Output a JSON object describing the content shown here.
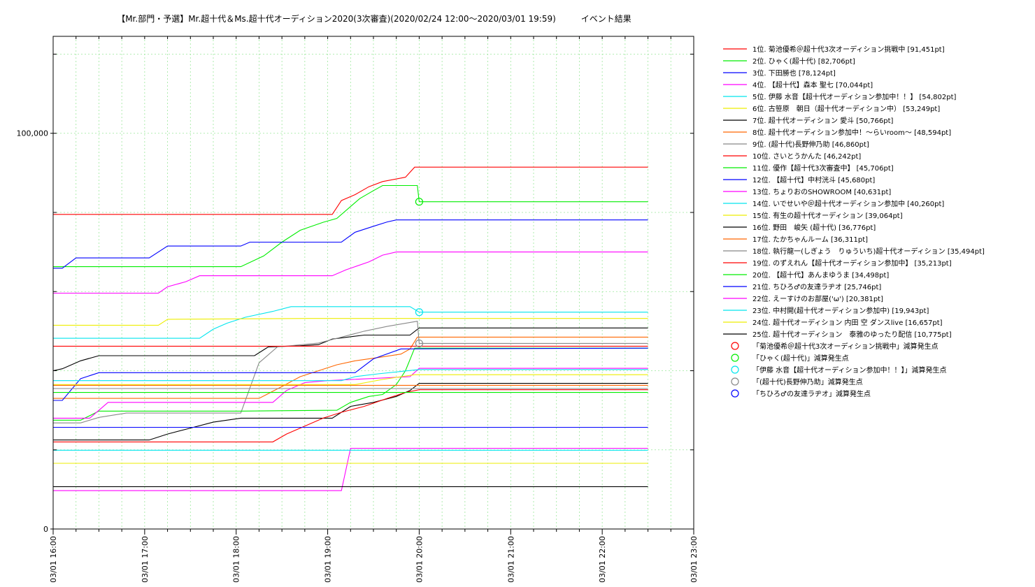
{
  "chart_data": {
    "type": "line",
    "title": "【Mr.部門・予選】Mr.超十代＆Ms.超十代オーディション2020(3次審査)(2020/02/24 12:00～2020/03/01 19:59)　　　イベント結果",
    "xlabel": "",
    "ylabel": "",
    "xlim": [
      0,
      7
    ],
    "ylim": [
      0,
      100000
    ],
    "yticks": [
      {
        "value": 0,
        "label": "0"
      },
      {
        "value": 100000,
        "label": "100,000"
      }
    ],
    "x_tick_labels": [
      "03/01 16:00",
      "03/01 17:00",
      "03/01 18:00",
      "03/01 19:00",
      "03/01 20:00",
      "03/01 21:00",
      "03/01 22:00",
      "03/01 23:00"
    ],
    "grid": true,
    "legend_position": "right",
    "series": [
      {
        "name": "1位. 菊池優希＠超十代3次オーディション挑戦中 [91,451pt]",
        "color": "#ff0000",
        "points": [
          [
            0,
            79500
          ],
          [
            3.05,
            79500
          ],
          [
            3.15,
            83000
          ],
          [
            3.3,
            84500
          ],
          [
            3.45,
            86500
          ],
          [
            3.6,
            87800
          ],
          [
            3.85,
            88900
          ],
          [
            3.95,
            91450
          ],
          [
            6.5,
            91450
          ]
        ]
      },
      {
        "name": "2位. ひゃく(超十代) [82,706pt]",
        "color": "#00ee00",
        "points": [
          [
            0,
            66300
          ],
          [
            2.05,
            66300
          ],
          [
            2.3,
            69000
          ],
          [
            2.5,
            72500
          ],
          [
            2.7,
            75500
          ],
          [
            2.95,
            77500
          ],
          [
            3.1,
            78500
          ],
          [
            3.35,
            83500
          ],
          [
            3.5,
            85500
          ],
          [
            3.6,
            86800
          ],
          [
            3.75,
            86800
          ],
          [
            3.98,
            86800
          ],
          [
            4.0,
            82700
          ],
          [
            6.5,
            82700
          ]
        ]
      },
      {
        "name": "3位. 下田勝也 [78,124pt]",
        "color": "#0000ff",
        "points": [
          [
            0,
            65900
          ],
          [
            0.1,
            65900
          ],
          [
            0.25,
            68500
          ],
          [
            1.05,
            68500
          ],
          [
            1.25,
            71500
          ],
          [
            2.05,
            71500
          ],
          [
            2.15,
            72500
          ],
          [
            3.15,
            72500
          ],
          [
            3.3,
            75000
          ],
          [
            3.5,
            76500
          ],
          [
            3.65,
            77600
          ],
          [
            3.75,
            78100
          ],
          [
            6.5,
            78100
          ]
        ]
      },
      {
        "name": "4位. 【超十代】森本 聖七 [70,044pt]",
        "color": "#ff00ff",
        "points": [
          [
            0,
            59600
          ],
          [
            1.15,
            59600
          ],
          [
            1.25,
            61200
          ],
          [
            1.45,
            62500
          ],
          [
            1.6,
            64000
          ],
          [
            3.05,
            64000
          ],
          [
            3.2,
            65500
          ],
          [
            3.45,
            67500
          ],
          [
            3.6,
            69200
          ],
          [
            3.75,
            70000
          ],
          [
            6.5,
            70000
          ]
        ]
      },
      {
        "name": "5位. 伊藤 水音【超十代オーディション参加中！！】 [54,802pt]",
        "color": "#00e5ee",
        "points": [
          [
            0,
            48200
          ],
          [
            1.6,
            48200
          ],
          [
            1.75,
            50500
          ],
          [
            1.9,
            52000
          ],
          [
            2.1,
            53500
          ],
          [
            2.4,
            55000
          ],
          [
            2.6,
            56200
          ],
          [
            3.9,
            56200
          ],
          [
            4.0,
            54800
          ],
          [
            6.5,
            54800
          ]
        ]
      },
      {
        "name": "6位. 古笹原　朝日（超十代オーディション中） [53,249pt]",
        "color": "#eeee00",
        "points": [
          [
            0,
            51500
          ],
          [
            1.15,
            51500
          ],
          [
            1.25,
            53000
          ],
          [
            2.8,
            53200
          ],
          [
            6.5,
            53200
          ]
        ]
      },
      {
        "name": "7位. 超十代オーディション 愛斗 [50,766pt]",
        "color": "#000000",
        "points": [
          [
            0,
            40000
          ],
          [
            0.1,
            40500
          ],
          [
            0.3,
            42500
          ],
          [
            0.5,
            43800
          ],
          [
            2.2,
            43800
          ],
          [
            2.35,
            46000
          ],
          [
            2.7,
            46300
          ],
          [
            2.9,
            46600
          ],
          [
            3.05,
            48000
          ],
          [
            3.4,
            49000
          ],
          [
            3.9,
            49000
          ],
          [
            4.0,
            50800
          ],
          [
            6.5,
            50800
          ]
        ]
      },
      {
        "name": "8位. 超十代オーディション参加中！～らいroom～ [48,594pt]",
        "color": "#ff6600",
        "points": [
          [
            0,
            33000
          ],
          [
            2.25,
            33000
          ],
          [
            2.5,
            36000
          ],
          [
            2.7,
            38500
          ],
          [
            2.9,
            40000
          ],
          [
            3.1,
            41500
          ],
          [
            3.3,
            42500
          ],
          [
            3.6,
            43500
          ],
          [
            3.8,
            44200
          ],
          [
            3.9,
            45500
          ],
          [
            3.98,
            48500
          ],
          [
            6.5,
            48500
          ]
        ]
      },
      {
        "name": "9位. (超十代)長野伸乃助 [46,860pt]",
        "color": "#888888",
        "points": [
          [
            0,
            26800
          ],
          [
            0.3,
            26800
          ],
          [
            0.5,
            28200
          ],
          [
            0.8,
            29300
          ],
          [
            2.05,
            29300
          ],
          [
            2.25,
            42000
          ],
          [
            2.45,
            46000
          ],
          [
            2.9,
            47000
          ],
          [
            3.1,
            48200
          ],
          [
            3.4,
            50000
          ],
          [
            3.65,
            51200
          ],
          [
            3.8,
            51800
          ],
          [
            3.98,
            52500
          ],
          [
            4.0,
            46900
          ],
          [
            6.5,
            46900
          ]
        ]
      },
      {
        "name": "10位. さいとうかんた [46,242pt]",
        "color": "#ff0000",
        "points": [
          [
            0,
            46200
          ],
          [
            6.5,
            46200
          ]
        ]
      },
      {
        "name": "11位. 優作【超十代3次審査中】 [45,706pt]",
        "color": "#00ee00",
        "points": [
          [
            0,
            27500
          ],
          [
            0.3,
            27500
          ],
          [
            0.5,
            29800
          ],
          [
            2.05,
            29800
          ],
          [
            3.1,
            30000
          ],
          [
            3.25,
            32000
          ],
          [
            3.45,
            33500
          ],
          [
            3.6,
            34000
          ],
          [
            3.75,
            36500
          ],
          [
            3.85,
            40000
          ],
          [
            3.95,
            45700
          ],
          [
            6.5,
            45700
          ]
        ]
      },
      {
        "name": "12位. 【超十代】中村洸斗 [45,680pt]",
        "color": "#0000ff",
        "points": [
          [
            0,
            32500
          ],
          [
            0.1,
            32500
          ],
          [
            0.3,
            38000
          ],
          [
            0.5,
            39500
          ],
          [
            2.05,
            39500
          ],
          [
            3.3,
            39500
          ],
          [
            3.5,
            43000
          ],
          [
            3.8,
            45500
          ],
          [
            6.5,
            45700
          ]
        ]
      },
      {
        "name": "13位. ちょりおのSHOWROOM [40,631pt]",
        "color": "#ff00ff",
        "points": [
          [
            0,
            28000
          ],
          [
            0.4,
            28000
          ],
          [
            0.6,
            32000
          ],
          [
            2.4,
            32000
          ],
          [
            2.55,
            35000
          ],
          [
            2.75,
            37000
          ],
          [
            3.0,
            37500
          ],
          [
            3.9,
            38500
          ],
          [
            4.0,
            40600
          ],
          [
            6.5,
            40600
          ]
        ]
      },
      {
        "name": "14位. いでせいや＠超十代オーディション参加中 [40,260pt]",
        "color": "#00e5ee",
        "points": [
          [
            0,
            37500
          ],
          [
            3.15,
            37500
          ],
          [
            3.3,
            38500
          ],
          [
            3.55,
            39200
          ],
          [
            4.0,
            40300
          ],
          [
            6.5,
            40300
          ]
        ]
      },
      {
        "name": "15位. 有生の超十代オーディション [39,064pt]",
        "color": "#eeee00",
        "points": [
          [
            0,
            36500
          ],
          [
            3.3,
            36500
          ],
          [
            3.6,
            37800
          ],
          [
            3.95,
            39000
          ],
          [
            6.5,
            39000
          ]
        ]
      },
      {
        "name": "16位. 野田　峻矢 (超十代) [36,776pt]",
        "color": "#000000",
        "points": [
          [
            0,
            22500
          ],
          [
            1.05,
            22500
          ],
          [
            1.25,
            24000
          ],
          [
            1.5,
            25500
          ],
          [
            1.75,
            27000
          ],
          [
            2.05,
            28000
          ],
          [
            3.05,
            28000
          ],
          [
            3.25,
            31000
          ],
          [
            3.5,
            32000
          ],
          [
            3.75,
            33500
          ],
          [
            3.9,
            35000
          ],
          [
            4.0,
            36800
          ],
          [
            6.5,
            36800
          ]
        ]
      },
      {
        "name": "17位. たかちゃんルーム [36,311pt]",
        "color": "#ff6600",
        "points": [
          [
            0,
            36300
          ],
          [
            6.5,
            36300
          ]
        ]
      },
      {
        "name": "18位. 執行龍一(しぎょう　りゅういち)超十代オーディション [35,494pt]",
        "color": "#888888",
        "points": [
          [
            0,
            35500
          ],
          [
            6.5,
            35500
          ]
        ]
      },
      {
        "name": "19位. のずえれん【超十代オーディション参加中】 [35,213pt]",
        "color": "#ff0000",
        "points": [
          [
            0,
            22000
          ],
          [
            2.4,
            22000
          ],
          [
            2.55,
            24000
          ],
          [
            2.75,
            26000
          ],
          [
            2.95,
            28000
          ],
          [
            3.15,
            29500
          ],
          [
            3.4,
            31000
          ],
          [
            3.65,
            33000
          ],
          [
            3.85,
            34500
          ],
          [
            4.0,
            35200
          ],
          [
            6.5,
            35200
          ]
        ]
      },
      {
        "name": "20位. 【超十代】あんまゆうま [34,498pt]",
        "color": "#00ee00",
        "points": [
          [
            0,
            34500
          ],
          [
            6.5,
            34500
          ]
        ]
      },
      {
        "name": "21位. ちひろ♂の友達ラヂオ [25,746pt]",
        "color": "#0000ff",
        "points": [
          [
            0,
            25700
          ],
          [
            6.5,
            25700
          ]
        ]
      },
      {
        "name": "22位. えーすけのお部屋('ω') [20,381pt]",
        "color": "#ff00ff",
        "points": [
          [
            0,
            9700
          ],
          [
            3.15,
            9700
          ],
          [
            3.25,
            20400
          ],
          [
            6.5,
            20400
          ]
        ]
      },
      {
        "name": "23位. 中村開(超十代オーディション参加中) [19,943pt]",
        "color": "#00e5ee",
        "points": [
          [
            0,
            19900
          ],
          [
            6.5,
            19900
          ]
        ]
      },
      {
        "name": "24位. 超十代オーディション 内田 空 ダンスlive [16,657pt]",
        "color": "#eeee00",
        "points": [
          [
            0,
            16600
          ],
          [
            6.5,
            16600
          ]
        ]
      },
      {
        "name": "25位. 超十代オーディション　泰雅のゆったり配信 [10,775pt]",
        "color": "#000000",
        "points": [
          [
            0,
            10700
          ],
          [
            6.5,
            10700
          ]
        ]
      }
    ],
    "markers": [
      {
        "label": "「菊池優希＠超十代3次オーディション挑戦中」減算発生点",
        "color": "#ff0000",
        "x": null,
        "y": null
      },
      {
        "label": "「ひゃく(超十代)」減算発生点",
        "color": "#00ee00",
        "x": 4.0,
        "y": 82700
      },
      {
        "label": "「伊藤 水音【超十代オーディション参加中！！】」減算発生点",
        "color": "#00e5ee",
        "x": 4.0,
        "y": 54800
      },
      {
        "label": "「(超十代)長野伸乃助」減算発生点",
        "color": "#888888",
        "x": 4.0,
        "y": 46900
      },
      {
        "label": "「ちひろ♂の友達ラヂオ」減算発生点",
        "color": "#0000ff",
        "x": null,
        "y": null
      }
    ]
  }
}
